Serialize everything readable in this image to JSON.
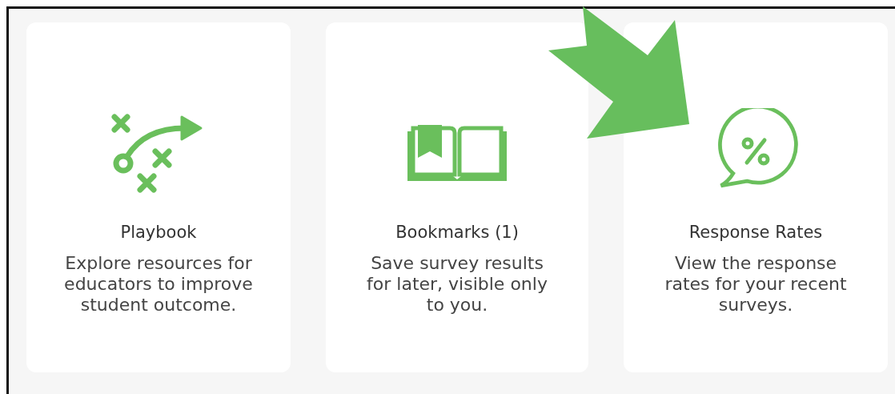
{
  "cards": [
    {
      "kind": "playbook",
      "title": "Playbook",
      "description": "Explore resources for educators to improve student outcome."
    },
    {
      "kind": "bookmarks",
      "title": "Bookmarks (1)",
      "description": "Save survey results for later, visible only to you."
    },
    {
      "kind": "response-rates",
      "title": "Response Rates",
      "description": "View the response rates for your recent surveys."
    }
  ]
}
